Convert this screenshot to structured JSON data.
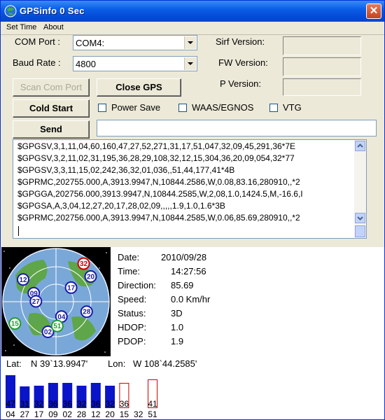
{
  "window": {
    "title": "GPSinfo  0 Sec",
    "close_glyph": "✕"
  },
  "menu": {
    "items": [
      "Set Time",
      "About"
    ]
  },
  "form": {
    "com_port_label": "COM Port :",
    "com_port_value": "COM4:",
    "baud_rate_label": "Baud Rate :",
    "baud_rate_value": "4800",
    "sirf_version_label": "Sirf Version:",
    "fw_version_label": "FW Version:",
    "p_version_label": "P Version:",
    "scan_com_port_label": "Scan Com Port",
    "close_gps_label": "Close GPS",
    "cold_start_label": "Cold Start",
    "power_save_label": "Power Save",
    "waas_label": "WAAS/EGNOS",
    "vtg_label": "VTG",
    "send_label": "Send",
    "send_input_value": ""
  },
  "nmea_log": [
    "$GPGSV,3,1,11,04,60,160,47,27,52,271,31,17,51,047,32,09,45,291,36*7E",
    "$GPGSV,3,2,11,02,31,195,36,28,29,108,32,12,15,304,36,20,09,054,32*77",
    "$GPGSV,3,3,11,15,02,242,36,32,01,036,,51,44,177,41*4B",
    "$GPRMC,202755.000,A,3913.9947,N,10844.2586,W,0.08,83.16,280910,,*2",
    "$GPGGA,202756.000,3913.9947,N,10844.2585,W,2,08,1.0,1424.5,M,-16.6,I",
    "$GPGSA,A,3,04,12,27,20,17,28,02,09,,,,,1.9,1.0,1.6*3B",
    "$GPRMC,202756.000,A,3913.9947,N,10844.2585,W,0.06,85.69,280910,,*2"
  ],
  "status": {
    "date_label": "Date:",
    "date_value": "2010/09/28",
    "time_label": "Time:",
    "time_value": "14:27:56",
    "direction_label": "Direction:",
    "direction_value": "85.69",
    "speed_label": "Speed:",
    "speed_value": "0.0 Km/hr",
    "status_label": "Status:",
    "status_value": "3D",
    "hdop_label": "HDOP:",
    "hdop_value": "1.0",
    "pdop_label": "PDOP:",
    "pdop_value": "1.9",
    "lat_label": "Lat:",
    "lat_value": "N  39`13.9947'",
    "lon_label": "Lon:",
    "lon_value": "W  108`44.2585'"
  },
  "skyplot": {
    "satellites": [
      {
        "prn": "32",
        "elev": 1,
        "az": 36,
        "color": "#cc0000"
      },
      {
        "prn": "20",
        "elev": 9,
        "az": 54,
        "color": "#1a1aa6"
      },
      {
        "prn": "17",
        "elev": 51,
        "az": 47,
        "color": "#1a1aa6"
      },
      {
        "prn": "12",
        "elev": 15,
        "az": 304,
        "color": "#1a1aa6"
      },
      {
        "prn": "09",
        "elev": 45,
        "az": 291,
        "color": "#1a1aa6"
      },
      {
        "prn": "27",
        "elev": 52,
        "az": 271,
        "color": "#1a1aa6"
      },
      {
        "prn": "28",
        "elev": 29,
        "az": 108,
        "color": "#1a1aa6"
      },
      {
        "prn": "04",
        "elev": 60,
        "az": 160,
        "color": "#1a1aa6"
      },
      {
        "prn": "02",
        "elev": 31,
        "az": 195,
        "color": "#1a1aa6"
      },
      {
        "prn": "15",
        "elev": 2,
        "az": 242,
        "color": "#1f9e2a"
      },
      {
        "prn": "51",
        "elev": 44,
        "az": 177,
        "color": "#1f9e2a"
      }
    ]
  },
  "chart_data": {
    "type": "bar",
    "categories": [
      "04",
      "27",
      "17",
      "09",
      "02",
      "28",
      "12",
      "20",
      "15",
      "32",
      "51"
    ],
    "values": [
      47,
      31,
      32,
      36,
      36,
      32,
      36,
      32,
      36,
      null,
      41
    ],
    "bar_labels": [
      "47",
      "31",
      "32",
      "36",
      "36",
      "32",
      "36",
      "32",
      "36",
      "",
      "41"
    ],
    "used_in_fix": [
      true,
      true,
      true,
      true,
      true,
      true,
      true,
      true,
      false,
      false,
      false
    ],
    "ylim": [
      0,
      50
    ],
    "colors": {
      "used": "#0a14c8",
      "unused_outline": "#cc0000"
    }
  }
}
